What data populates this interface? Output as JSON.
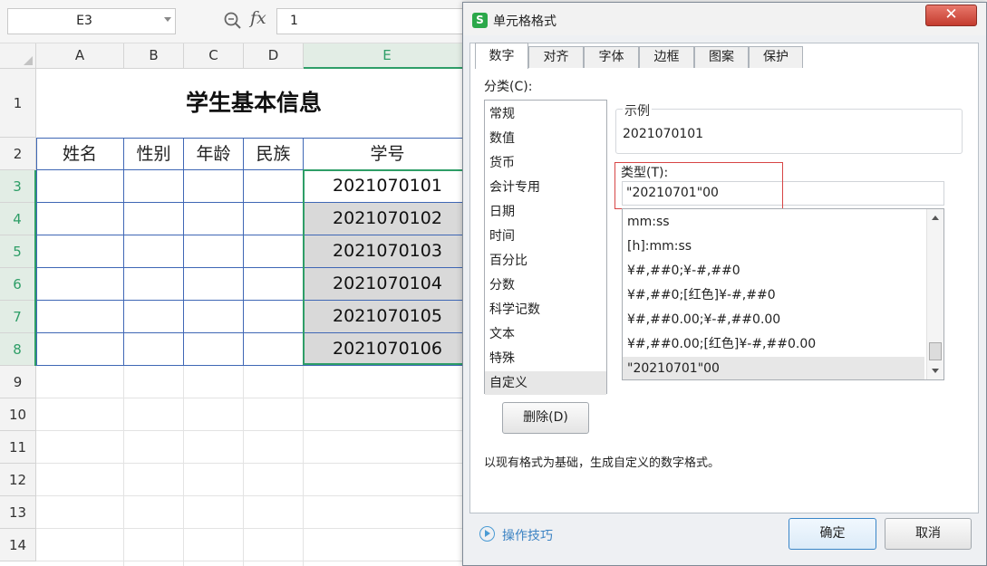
{
  "formula_bar": {
    "cell_ref": "E3",
    "formula_value": "1"
  },
  "sheet": {
    "columns": [
      "A",
      "B",
      "C",
      "D",
      "E"
    ],
    "rows": [
      "1",
      "2",
      "3",
      "4",
      "5",
      "6",
      "7",
      "8",
      "9",
      "10",
      "11",
      "12",
      "13",
      "14"
    ],
    "title": "学生基本信息",
    "headers": [
      "姓名",
      "性别",
      "年龄",
      "民族",
      "学号"
    ],
    "ids": [
      "2021070101",
      "2021070102",
      "2021070103",
      "2021070104",
      "2021070105",
      "2021070106"
    ],
    "selected_column": "E",
    "selected_rows": [
      "3",
      "4",
      "5",
      "6",
      "7",
      "8"
    ]
  },
  "dialog": {
    "title": "单元格格式",
    "close_label": "✕",
    "tabs": [
      "数字",
      "对齐",
      "字体",
      "边框",
      "图案",
      "保护"
    ],
    "active_tab": "数字",
    "category_label": "分类(C):",
    "categories": [
      "常规",
      "数值",
      "货币",
      "会计专用",
      "日期",
      "时间",
      "百分比",
      "分数",
      "科学记数",
      "文本",
      "特殊",
      "自定义"
    ],
    "selected_category": "自定义",
    "sample_label": "示例",
    "sample_value": "2021070101",
    "type_label": "类型(T):",
    "type_value": "\"20210701\"00",
    "formats": [
      "mm:ss",
      "[h]:mm:ss",
      "¥#,##0;¥-#,##0",
      "¥#,##0;[红色]¥-#,##0",
      "¥#,##0.00;¥-#,##0.00",
      "¥#,##0.00;[红色]¥-#,##0.00",
      "\"20210701\"00"
    ],
    "selected_format": "\"20210701\"00",
    "delete_label": "删除(D)",
    "description": "以现有格式为基础，生成自定义的数字格式。",
    "tips_label": "操作技巧",
    "ok_label": "确定",
    "cancel_label": "取消"
  },
  "colors": {
    "selection_green": "#2e9e67",
    "table_border_blue": "#3f67b5",
    "highlight_red": "#d74545",
    "close_red": "#c43b2e",
    "app_icon_green": "#2ba84a",
    "link_blue": "#3c83c3"
  }
}
